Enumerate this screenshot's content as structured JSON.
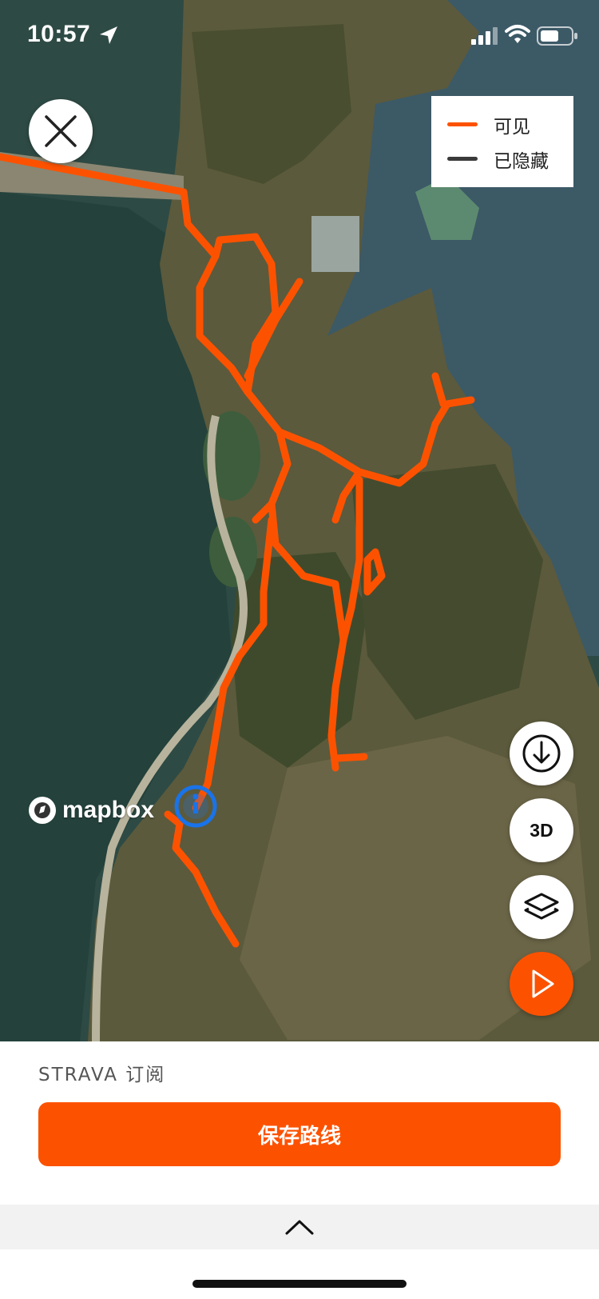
{
  "status_bar": {
    "time": "10:57",
    "icons": [
      "location-arrow-icon",
      "cellular-signal-icon",
      "wifi-icon",
      "battery-icon"
    ]
  },
  "map": {
    "legend": {
      "items": [
        {
          "label": "可见",
          "color": "#fc5200"
        },
        {
          "label": "已隐藏",
          "color": "#3a3a3a"
        }
      ]
    },
    "attribution": "mapbox",
    "controls": {
      "download_icon": "download-icon",
      "three_d_label": "3D",
      "layers_icon": "layers-icon",
      "play_icon": "play-icon"
    }
  },
  "panel": {
    "subscription_label": "STRAVA 订阅",
    "save_route_label": "保存路线",
    "drawer_icon": "chevron-up-icon"
  },
  "colors": {
    "accent": "#fc5200",
    "route": "#fc5200",
    "location_marker": "#1a73e8"
  }
}
